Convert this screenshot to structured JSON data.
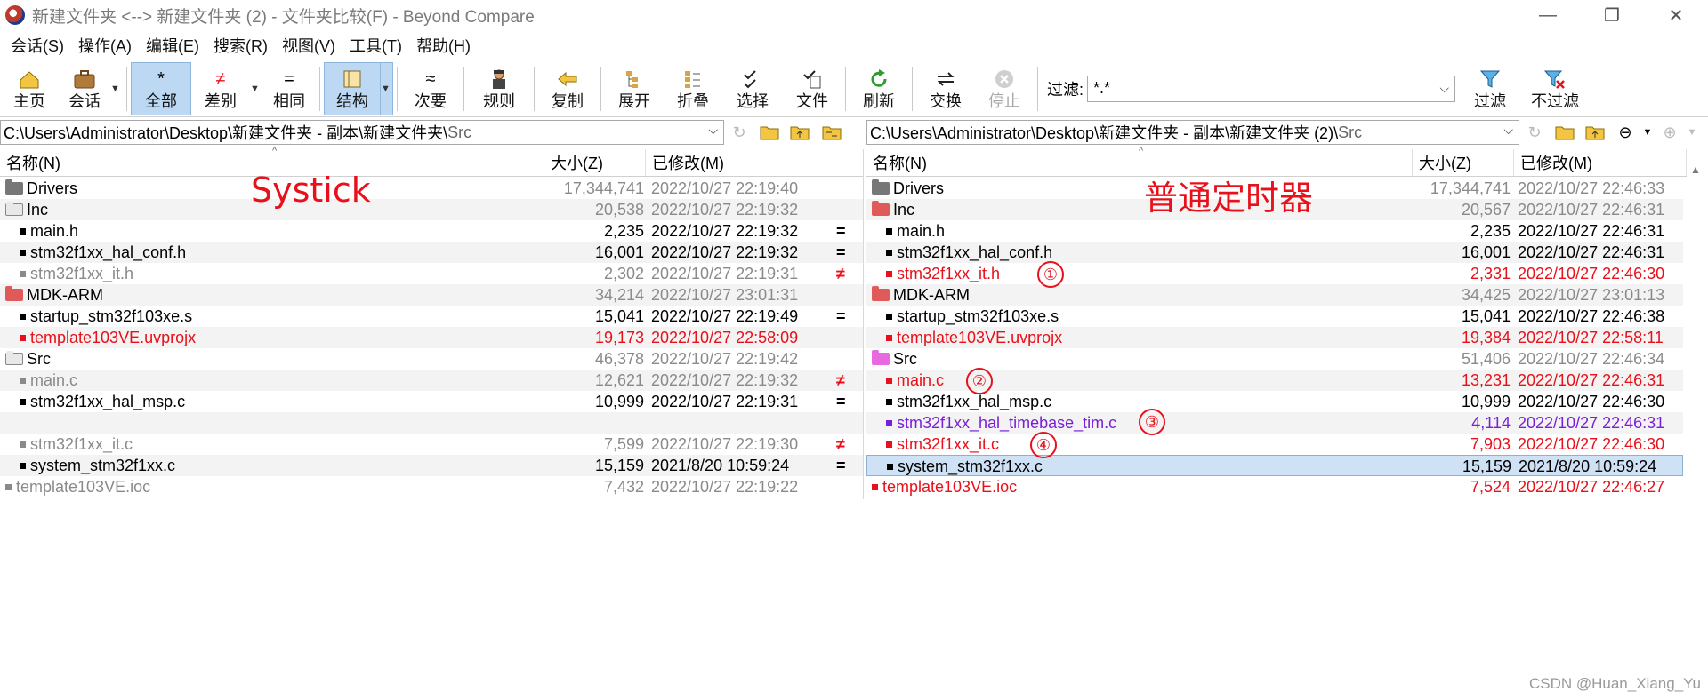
{
  "window": {
    "title": "新建文件夹 <--> 新建文件夹 (2) - 文件夹比较(F) - Beyond Compare",
    "controls": [
      "—",
      "❐",
      "✕"
    ]
  },
  "menu": [
    "会话(S)",
    "操作(A)",
    "编辑(E)",
    "搜索(R)",
    "视图(V)",
    "工具(T)",
    "帮助(H)"
  ],
  "toolbar": {
    "home": "主页",
    "session": "会话",
    "all": "全部",
    "diffs": "差别",
    "same": "相同",
    "structure": "结构",
    "minor": "次要",
    "rules": "规则",
    "copy": "复制",
    "expand": "展开",
    "collapse": "折叠",
    "select": "选择",
    "files": "文件",
    "refresh": "刷新",
    "swap": "交换",
    "stop": "停止",
    "filter_label": "过滤:",
    "filter_value": "*.*",
    "filters": "过滤",
    "no_filters": "不过滤"
  },
  "left": {
    "path_prefix": "C:\\Users\\Administrator\\Desktop\\新建文件夹 - 副本\\新建文件夹\\",
    "path_tail": "Src",
    "col_name": "名称(N)",
    "col_size": "大小(Z)",
    "col_modified": "已修改(M)",
    "annotation": "Systick",
    "rows": [
      {
        "name": "Drivers",
        "size": "17,344,741",
        "modified": "2022/10/27 22:19:40"
      },
      {
        "name": "Inc",
        "size": "20,538",
        "modified": "2022/10/27 22:19:32"
      },
      {
        "name": "main.h",
        "size": "2,235",
        "modified": "2022/10/27 22:19:32"
      },
      {
        "name": "stm32f1xx_hal_conf.h",
        "size": "16,001",
        "modified": "2022/10/27 22:19:32"
      },
      {
        "name": "stm32f1xx_it.h",
        "size": "2,302",
        "modified": "2022/10/27 22:19:31"
      },
      {
        "name": "MDK-ARM",
        "size": "34,214",
        "modified": "2022/10/27 23:01:31"
      },
      {
        "name": "startup_stm32f103xe.s",
        "size": "15,041",
        "modified": "2022/10/27 22:19:49"
      },
      {
        "name": "template103VE.uvprojx",
        "size": "19,173",
        "modified": "2022/10/27 22:58:09"
      },
      {
        "name": "Src",
        "size": "46,378",
        "modified": "2022/10/27 22:19:42"
      },
      {
        "name": "main.c",
        "size": "12,621",
        "modified": "2022/10/27 22:19:32"
      },
      {
        "name": "stm32f1xx_hal_msp.c",
        "size": "10,999",
        "modified": "2022/10/27 22:19:31"
      },
      {
        "name": "",
        "size": "",
        "modified": ""
      },
      {
        "name": "stm32f1xx_it.c",
        "size": "7,599",
        "modified": "2022/10/27 22:19:30"
      },
      {
        "name": "system_stm32f1xx.c",
        "size": "15,159",
        "modified": "2021/8/20 10:59:24"
      },
      {
        "name": "template103VE.ioc",
        "size": "7,432",
        "modified": "2022/10/27 22:19:22"
      }
    ]
  },
  "right": {
    "path_prefix": "C:\\Users\\Administrator\\Desktop\\新建文件夹 - 副本\\新建文件夹 (2)\\",
    "path_tail": "Src",
    "col_name": "名称(N)",
    "col_size": "大小(Z)",
    "col_modified": "已修改(M)",
    "annotation": "普通定时器",
    "rows": [
      {
        "name": "Drivers",
        "size": "17,344,741",
        "modified": "2022/10/27 22:46:33"
      },
      {
        "name": "Inc",
        "size": "20,567",
        "modified": "2022/10/27 22:46:31"
      },
      {
        "name": "main.h",
        "size": "2,235",
        "modified": "2022/10/27 22:46:31"
      },
      {
        "name": "stm32f1xx_hal_conf.h",
        "size": "16,001",
        "modified": "2022/10/27 22:46:31"
      },
      {
        "name": "stm32f1xx_it.h",
        "size": "2,331",
        "modified": "2022/10/27 22:46:30"
      },
      {
        "name": "MDK-ARM",
        "size": "34,425",
        "modified": "2022/10/27 23:01:13"
      },
      {
        "name": "startup_stm32f103xe.s",
        "size": "15,041",
        "modified": "2022/10/27 22:46:38"
      },
      {
        "name": "template103VE.uvprojx",
        "size": "19,384",
        "modified": "2022/10/27 22:58:11"
      },
      {
        "name": "Src",
        "size": "51,406",
        "modified": "2022/10/27 22:46:34"
      },
      {
        "name": "main.c",
        "size": "13,231",
        "modified": "2022/10/27 22:46:31"
      },
      {
        "name": "stm32f1xx_hal_msp.c",
        "size": "10,999",
        "modified": "2022/10/27 22:46:30"
      },
      {
        "name": "stm32f1xx_hal_timebase_tim.c",
        "size": "4,114",
        "modified": "2022/10/27 22:46:31"
      },
      {
        "name": "stm32f1xx_it.c",
        "size": "7,903",
        "modified": "2022/10/27 22:46:30"
      },
      {
        "name": "system_stm32f1xx.c",
        "size": "15,159",
        "modified": "2021/8/20 10:59:24"
      },
      {
        "name": "template103VE.ioc",
        "size": "7,524",
        "modified": "2022/10/27 22:46:27"
      }
    ]
  },
  "markers": {
    "diff": "≠",
    "same": "=",
    "similar": "≈"
  },
  "circled": [
    "①",
    "②",
    "③",
    "④"
  ],
  "watermark": "CSDN @Huan_Xiang_Yu",
  "colors": {
    "diff": "#e8101a",
    "orphan": "#7b1fd6",
    "older": "#8a8a8a",
    "selection": "#cfe2f5"
  }
}
